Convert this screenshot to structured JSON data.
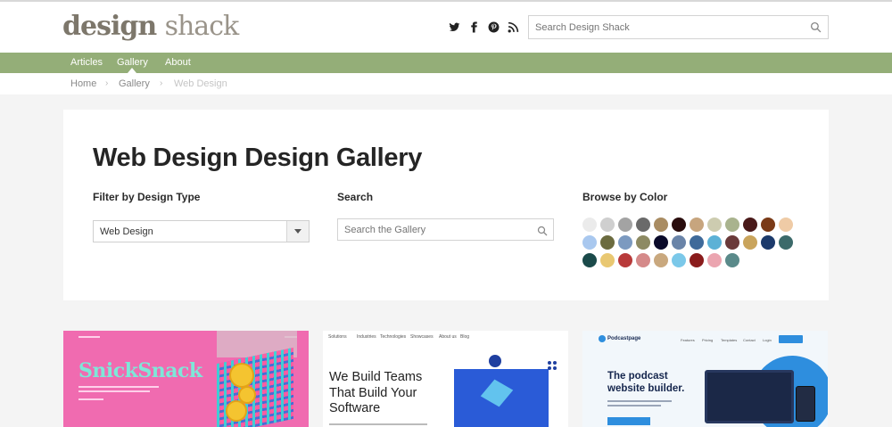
{
  "header": {
    "logo_bold": "design",
    "logo_light": "shack",
    "search_placeholder": "Search Design Shack",
    "social_icons": [
      "twitter-icon",
      "facebook-icon",
      "pinterest-icon",
      "rss-icon"
    ]
  },
  "nav": {
    "items": [
      {
        "label": "Articles"
      },
      {
        "label": "Gallery"
      },
      {
        "label": "About"
      }
    ],
    "active": "Gallery"
  },
  "breadcrumb": {
    "items": [
      "Home",
      "Gallery",
      "Web Design"
    ],
    "separator": "›"
  },
  "panel": {
    "title": "Web Design Design Gallery",
    "filter_label": "Filter by Design Type",
    "filter_value": "Web Design",
    "search_label": "Search",
    "search_placeholder": "Search the Gallery",
    "color_label": "Browse by Color",
    "colors": [
      "#ebebeb",
      "#cfcfcf",
      "#a3a3a3",
      "#6a6a6a",
      "#a98c62",
      "#2a0d0d",
      "#c7a57e",
      "#cdccb0",
      "#a9b38e",
      "#4a1a1a",
      "#7a3a17",
      "#efcba6",
      "#a9c8ef",
      "#6b6b3f",
      "#7c9ac0",
      "#8d8a63",
      "#0a0a2a",
      "#6a84a8",
      "#3f6a9a",
      "#5cb1d6",
      "#6a3a3a",
      "#c9a45c",
      "#1c3a6b",
      "#3c6a6a",
      "#1b4a4a",
      "#e9c872",
      "#b83a3a",
      "#d58a8a",
      "#c9a87e",
      "#7bc8e9",
      "#8a1c1c",
      "#eba5b0",
      "#5a8a8a"
    ]
  },
  "gallery": {
    "card1": {
      "title": "SnickSnack"
    },
    "card2": {
      "nav": [
        "Solutions",
        "Industries",
        "Technologies",
        "Showcases",
        "About us",
        "Blog"
      ],
      "title": "We Build Teams\nThat Build Your\nSoftware"
    },
    "card3": {
      "logo": "Podcastpage",
      "links": [
        "Features",
        "Pricing",
        "Templates",
        "Contact",
        "Login"
      ],
      "title": "The podcast\nwebsite builder."
    }
  }
}
